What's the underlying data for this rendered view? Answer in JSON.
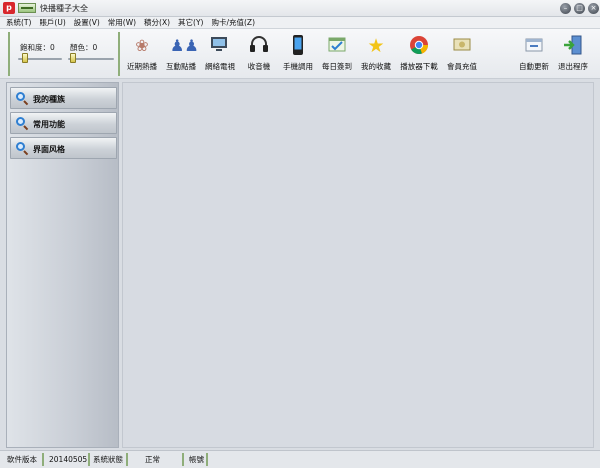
{
  "window": {
    "app_icon_glyph": "p",
    "title": "快播種子大全",
    "buttons": [
      "minimize",
      "maximize",
      "close"
    ]
  },
  "menu": [
    "系統(T)",
    "賬戶(U)",
    "設置(V)",
    "常用(W)",
    "積分(X)",
    "其它(Y)",
    "购卡/充值(Z)"
  ],
  "sliders": {
    "saturation": {
      "label": "飽和度：",
      "value": 0,
      "display": "0",
      "level": 0.1
    },
    "color": {
      "label": "顏色：",
      "value": 0,
      "display": "0",
      "level": 0.05
    }
  },
  "toolbar": [
    {
      "label": "近期熱播",
      "icon": "film-scatter-icon"
    },
    {
      "label": "互動點播",
      "icon": "users-icon"
    },
    {
      "label": "網絡電視",
      "icon": "tv-icon"
    },
    {
      "label": "收音機",
      "icon": "headphones-icon"
    },
    {
      "label": "手機調用",
      "icon": "mobile-phone-icon"
    },
    {
      "label": "每日簽到",
      "icon": "calendar-icon"
    },
    {
      "label": "我的收藏",
      "icon": "star-icon"
    },
    {
      "label": "播放器下載",
      "icon": "chrome-icon"
    },
    {
      "label": "會員充值",
      "icon": "money-icon"
    },
    {
      "label": "自動更新",
      "icon": "update-icon"
    },
    {
      "label": "退出程序",
      "icon": "exit-icon"
    }
  ],
  "sidebar": {
    "items": [
      {
        "label": "我的種族",
        "icon": "search-icon"
      },
      {
        "label": "常用功能",
        "icon": "search-icon"
      },
      {
        "label": "界面风格",
        "icon": "search-icon"
      }
    ]
  },
  "status": {
    "version_label": "軟件版本",
    "version_value": "20140505",
    "state_label": "系統狀態",
    "state_value": "正常",
    "account_label": "帳號",
    "account_value": ""
  },
  "colors": {
    "accent_green": "#8fae7a",
    "app_icon_red": "#d8262c",
    "main_bg": "#d7dbe2"
  }
}
